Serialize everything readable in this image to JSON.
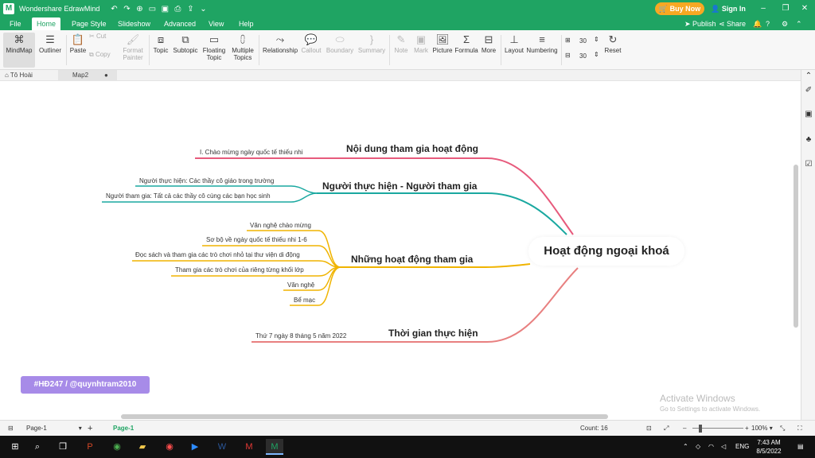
{
  "app": {
    "name": "Wondershare EdrawMind",
    "buy_now": "Buy Now",
    "sign_in": "Sign In",
    "accent": "#1fa463"
  },
  "menu": {
    "tabs": [
      "File",
      "Home",
      "Page Style",
      "Slideshow",
      "Advanced",
      "View",
      "Help"
    ],
    "active": "Home",
    "publish": "Publish",
    "share": "Share"
  },
  "ribbon": {
    "mindmap": "MindMap",
    "outliner": "Outliner",
    "paste": "Paste",
    "cut": "Cut",
    "copy": "Copy",
    "format_painter_1": "Format",
    "format_painter_2": "Painter",
    "topic": "Topic",
    "subtopic": "Subtopic",
    "floating_1": "Floating",
    "floating_2": "Topic",
    "multiple_1": "Multiple",
    "multiple_2": "Topics",
    "relationship": "Relationship",
    "callout": "Callout",
    "boundary": "Boundary",
    "summary": "Summary",
    "note": "Note",
    "mark": "Mark",
    "picture": "Picture",
    "formula": "Formula",
    "more": "More",
    "layout": "Layout",
    "numbering": "Numbering",
    "spacing_h": "30",
    "spacing_v": "30",
    "reset": "Reset"
  },
  "doc_tabs": [
    "Tô Hoài",
    "Map2"
  ],
  "mindmap": {
    "central": "Hoạt động ngoại khoá",
    "branches": [
      {
        "label": "Nội dung tham gia hoạt động",
        "color": "#e75a7c",
        "leaves": [
          "I. Chào mừng ngày quốc tế thiếu nhi"
        ]
      },
      {
        "label": "Người thực hiện - Người tham gia",
        "color": "#1aa8a0",
        "leaves": [
          "Người thực hiện: Các thầy cô giáo trong trường",
          "Người tham gia: Tất cả các thầy cô cùng các bạn học sinh"
        ]
      },
      {
        "label": "Những hoạt động tham gia",
        "color": "#f0b400",
        "leaves": [
          "Văn nghệ chào mừng",
          "Sơ bộ về ngày quốc tế thiếu nhi 1-6",
          "Đọc sách và tham gia các trò chơi nhỏ tại thư viện di động",
          "Tham gia các trò chơi của riêng từng khối lớp",
          "Văn nghệ",
          "Bể mạc"
        ]
      },
      {
        "label": "Thời gian thực hiện",
        "color": "#e88080",
        "leaves": [
          "Thứ 7 ngày 8 tháng 5 năm 2022"
        ]
      }
    ]
  },
  "badge": "#HĐ247 / @quynhtram2010",
  "activate": {
    "title": "Activate Windows",
    "subtitle": "Go to Settings to activate Windows."
  },
  "status": {
    "page_select": "Page-1",
    "page_tab": "Page-1",
    "count": "Count: 16",
    "zoom": "100%"
  },
  "taskbar": {
    "lang": "ENG",
    "time": "7:43 AM",
    "date": "8/5/2022"
  }
}
